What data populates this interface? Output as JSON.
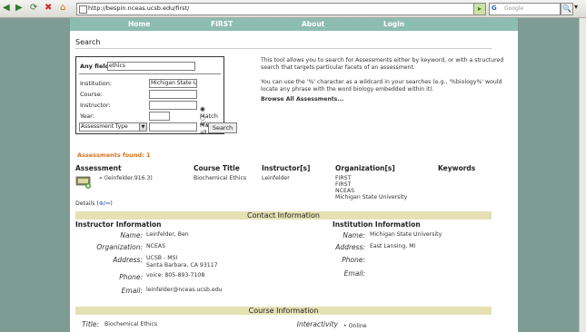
{
  "browser": {
    "url": "http://bespin.nceas.ucsb.edu/first/",
    "search_placeholder": "Google"
  },
  "nav": {
    "home": "Home",
    "first": "FIRST",
    "about": "About",
    "login": "Login"
  },
  "search": {
    "title": "Search",
    "any_field_label": "Any field:",
    "any_field_value": "ethics",
    "institution_label": "Institution:",
    "institution_value": "Michigan State Ur",
    "course_label": "Course:",
    "instructor_label": "Instructor:",
    "year_label": "Year:",
    "assessment_type": "Assessment Type",
    "match_any": "Match any",
    "match_all": "Match all",
    "search_button": "Search",
    "desc1": "This tool allows you to search for Assessments either by keyword, or with a structured search that targets particular facets of an assessment.",
    "desc2": "You can use the '%' character as a wildcard in your searches (e.g., '%biology%' would locate any phrase with the word biology embedded within it).",
    "browse_all": "Browse All Assessments..."
  },
  "results": {
    "found": "Assessments found: 1",
    "headers": [
      "Assessment",
      "Course Title",
      "Instructor[s]",
      "Organization[s]",
      "Keywords"
    ],
    "row": {
      "assessment": "» (leinfelder.916.3)",
      "course_title": "Biochemical Ethics",
      "instructor": "Leinfelder",
      "orgs": [
        "FIRST",
        "FIRST",
        "NCEAS",
        "Michigan State University"
      ]
    },
    "details": "Details (",
    "details_tail": ")"
  },
  "contact": {
    "bar": "Contact Information",
    "instructor_head": "Instructor Information",
    "institution_head": "Institution Information",
    "name_label": "Name:",
    "name_value": "Leinfelder, Ben",
    "org_label": "Organization:",
    "org_value": "NCEAS",
    "address_label": "Address:",
    "address_line1": "UCSB - MSI",
    "address_line2": "Santa Barbara, CA 93117",
    "phone_label": "Phone:",
    "phone_value": "voice: 805-893-7108",
    "email_label": "Email:",
    "email_value": "leinfelder@nceas.ucsb.edu",
    "inst_name_label": "Name:",
    "inst_name_value": "Michigan State University",
    "inst_address_label": "Address:",
    "inst_address_value": "East Lansing, MI",
    "inst_phone_label": "Phone:",
    "inst_email_label": "Email:"
  },
  "course": {
    "bar": "Course Information",
    "title_label": "Title:",
    "title_value": "Biochemical Ethics",
    "interactivity_label": "Interactivity",
    "interactivity_value": "• Online"
  }
}
